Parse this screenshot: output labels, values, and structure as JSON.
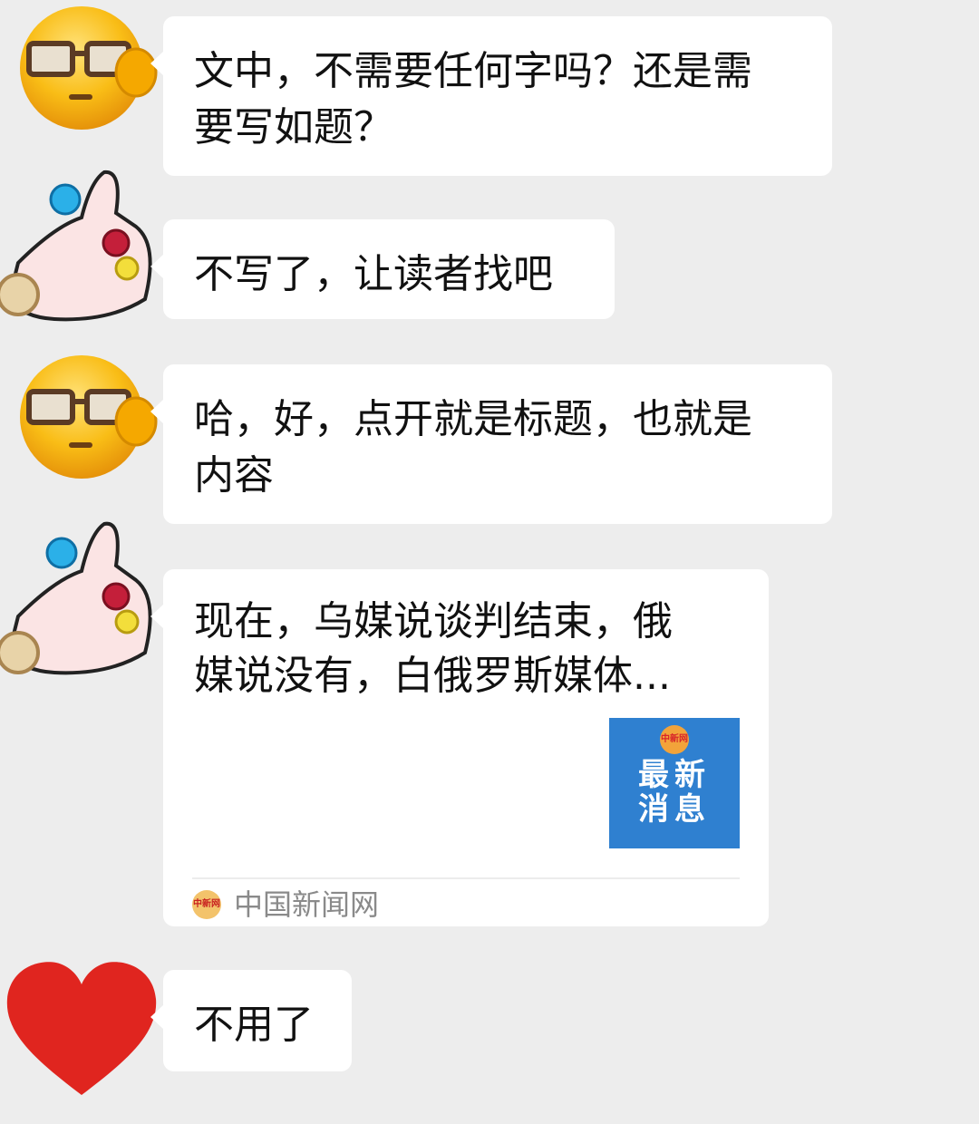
{
  "messages": [
    {
      "sender": "glasses-emoji",
      "text_lines": [
        "文中，不需要任何字吗？还是需",
        "要写如题？"
      ]
    },
    {
      "sender": "thumbs-up-jewels",
      "text_lines": [
        "不写了，让读者找吧"
      ]
    },
    {
      "sender": "glasses-emoji",
      "text_lines": [
        "哈，好，点开就是标题，也就是",
        "内容"
      ]
    },
    {
      "sender": "thumbs-up-jewels",
      "card": {
        "title_lines": [
          "现在，乌媒说谈判结束，俄",
          "媒说没有，白俄罗斯媒体..."
        ],
        "thumb_logo": "中新网",
        "thumb_text_lines": [
          "最新",
          "消息"
        ],
        "source_icon_text": "中新网",
        "source_name": "中国新闻网"
      }
    },
    {
      "sender": "red-heart",
      "text_lines": [
        "不用了"
      ]
    }
  ],
  "colors": {
    "background": "#ededed",
    "bubble": "#ffffff",
    "thumb_blue": "#2f80d0",
    "heart_red": "#e0251f",
    "emoji_yellow": "#f7b500"
  }
}
